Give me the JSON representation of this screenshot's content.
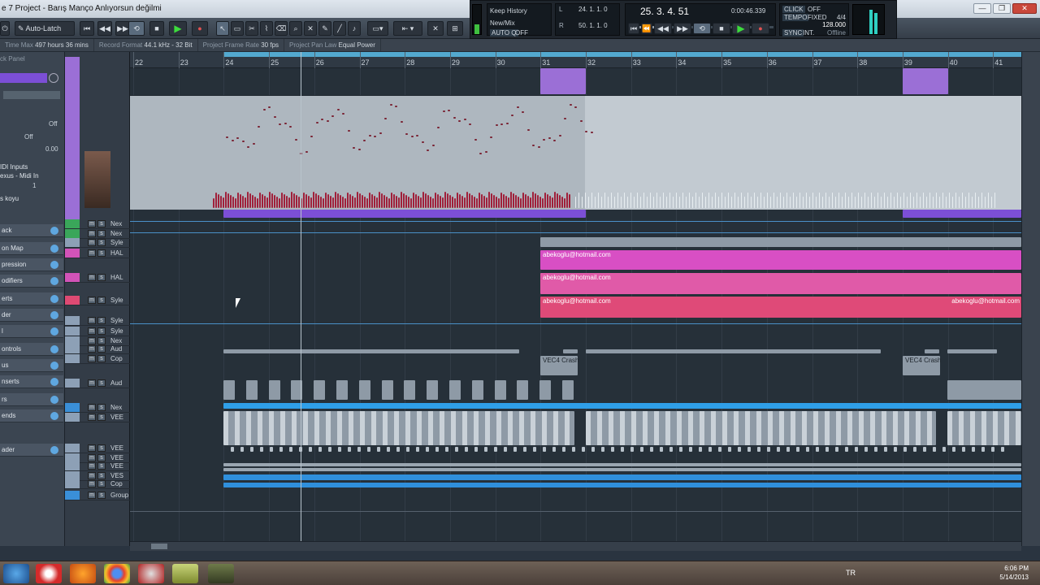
{
  "window": {
    "title": "e 7 Project - Barış Manço Anlıyorsun değilmi",
    "buttons": [
      "—",
      "❐",
      "✕"
    ]
  },
  "toolbar": {
    "automation_mode": "Auto-Latch",
    "tools": [
      "arrow",
      "range",
      "split",
      "glue",
      "erase",
      "zoom",
      "mute",
      "draw",
      "line",
      "play",
      "speaker"
    ]
  },
  "infobar": {
    "items": [
      {
        "label": "Time Max",
        "value": "497 hours 36 mins"
      },
      {
        "label": "Record Format",
        "value": "44.1 kHz - 32 Bit"
      },
      {
        "label": "Project Frame Rate",
        "value": "30 fps"
      },
      {
        "label": "Project Pan Law",
        "value": "Equal Power"
      }
    ]
  },
  "transport": {
    "history_label": "Keep History",
    "mode_label": "New/Mix",
    "auto_q": "AUTO Q",
    "auto_q_state": "OFF",
    "left_locator": "24. 1. 1. 0",
    "right_locator": "50. 1. 1. 0",
    "position_bars": "25. 3. 4. 51",
    "position_time": "0:00:46.339",
    "click": "CLICK",
    "click_state": "OFF",
    "tempo": "TEMPO",
    "tempo_mode": "FIXED",
    "signature": "4/4",
    "bpm": "128.000",
    "sync": "SYNC",
    "sync_source": "INT.",
    "sync_state": "Offline"
  },
  "inspector": {
    "header": "ck Panel",
    "off_label_1": "Off",
    "off_label_2": "Off",
    "value": "0.00",
    "midi_inputs": "IDI Inputs",
    "midi_out": "exus - Midi In",
    "channel": "1",
    "track_name": "s koyu",
    "sections": [
      "ack",
      "on Map",
      "pression",
      "odifiers",
      "erts",
      "der",
      "l",
      "ontrols",
      "us",
      "nserts",
      "rs",
      "ends",
      "ader"
    ]
  },
  "tracks": [
    {
      "name": "Nex",
      "color": "#3aa65a"
    },
    {
      "name": "Nex",
      "color": "#3aa65a"
    },
    {
      "name": "Syle",
      "color": "#8da0b6"
    },
    {
      "name": "HAL",
      "color": "#d253b8"
    },
    {
      "name": "HAL",
      "color": "#d253b8"
    },
    {
      "name": "Syle",
      "color": "#de4a73"
    },
    {
      "name": "Syle",
      "color": "#8da0b6"
    },
    {
      "name": "Syle",
      "color": "#8da0b6"
    },
    {
      "name": "Nex",
      "color": "#8da0b6"
    },
    {
      "name": "Aud",
      "color": "#8da0b6"
    },
    {
      "name": "Cop",
      "color": "#8da0b6"
    },
    {
      "name": "Aud",
      "color": "#8da0b6"
    },
    {
      "name": "Nex",
      "color": "#3a8fd8"
    },
    {
      "name": "VEE",
      "color": "#8da0b6"
    },
    {
      "name": "VEE",
      "color": "#8da0b6"
    },
    {
      "name": "VEE",
      "color": "#8da0b6"
    },
    {
      "name": "VEE",
      "color": "#8da0b6"
    },
    {
      "name": "VES",
      "color": "#8da0b6"
    },
    {
      "name": "Cop",
      "color": "#8da0b6"
    },
    {
      "name": "Group Tra",
      "color": "#3a8fd8"
    }
  ],
  "ruler": {
    "bars": [
      "22",
      "23",
      "24",
      "25",
      "26",
      "27",
      "28",
      "29",
      "30",
      "31",
      "32",
      "33",
      "34",
      "35",
      "36",
      "37",
      "38",
      "39",
      "40",
      "41"
    ]
  },
  "events": {
    "email_label": "abekoglu@hotmail.com",
    "crash_label": "VEC4 Crash"
  },
  "taskbar": {
    "lang": "TR",
    "time": "6:06 PM",
    "date": "5/14/2013"
  },
  "colors": {
    "midi_part": "#9b6fd6",
    "pink_part": "#d84fc4",
    "rose_part": "#df4a78",
    "blue_part": "#2f8fdc",
    "audio_gray": "#8e9aa6"
  }
}
